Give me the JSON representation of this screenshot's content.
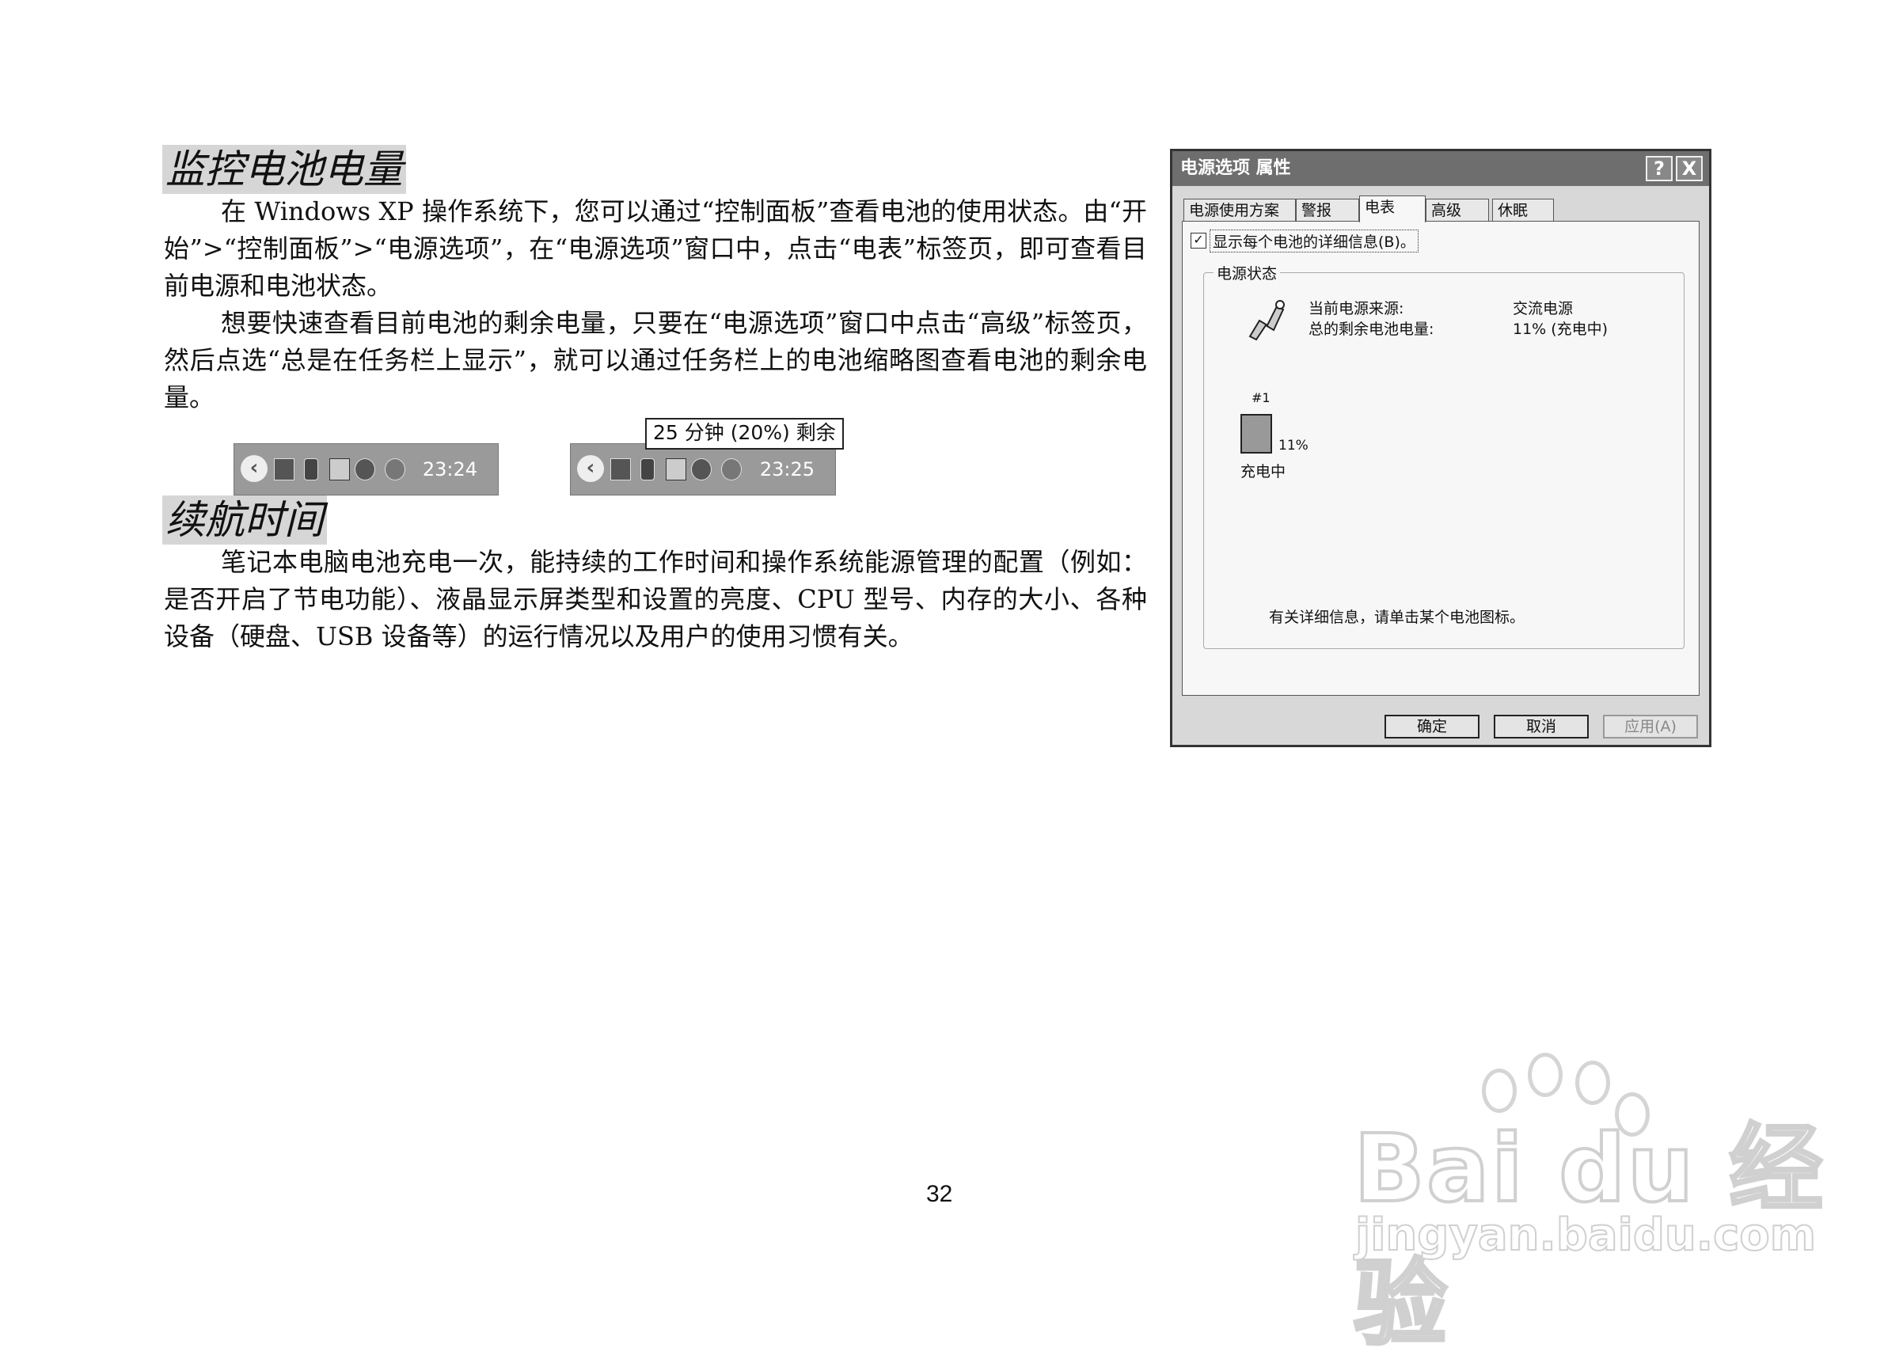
{
  "doc": {
    "heading1": "监控电池电量",
    "para1": "在 Windows XP 操作系统下，您可以通过“控制面板”查看电池的使用状态。由“开始”>“控制面板”>“电源选项”，在“电源选项”窗口中，点击“电表”标签页，即可查看目前电源和电池状态。",
    "para2": "想要快速查看目前电池的剩余电量，只要在“电源选项”窗口中点击“高级”标签页，然后点选“总是在任务栏上显示”，就可以通过任务栏上的电池缩略图查看电池的剩余电量。",
    "heading2": "续航时间",
    "para3": "笔记本电脑电池充电一次，能持续的工作时间和操作系统能源管理的配置（例如：是否开启了节电功能）、液晶显示屏类型和设置的亮度、CPU 型号、内存的大小、各种设备（硬盘、USB 设备等）的运行情况以及用户的使用习惯有关。",
    "page_number": "32"
  },
  "tray1": {
    "time": "23:24"
  },
  "tray2": {
    "time": "23:25",
    "tooltip": "25 分钟 (20%) 剩余"
  },
  "dialog": {
    "title": "电源选项 属性",
    "help_btn": "?",
    "close_btn": "X",
    "tabs": [
      "电源使用方案",
      "警报",
      "电表",
      "高级",
      "休眠"
    ],
    "active_tab": "电表",
    "checkbox_label": "显示每个电池的详细信息(B)。",
    "checkbox_checked": true,
    "group_label": "电源状态",
    "source_label": "当前电源来源:",
    "source_value": "交流电源",
    "remaining_label": "总的剩余电池电量:",
    "remaining_value": "11%  (充电中)",
    "battery_number": "#1",
    "battery_percent": "11%",
    "battery_state": "充电中",
    "info_text": "有关详细信息，请单击某个电池图标。",
    "ok": "确定",
    "cancel": "取消",
    "apply": "应用(A)"
  },
  "watermark": {
    "brand": "Bai du 经验",
    "url": "jingyan.baidu.com"
  }
}
